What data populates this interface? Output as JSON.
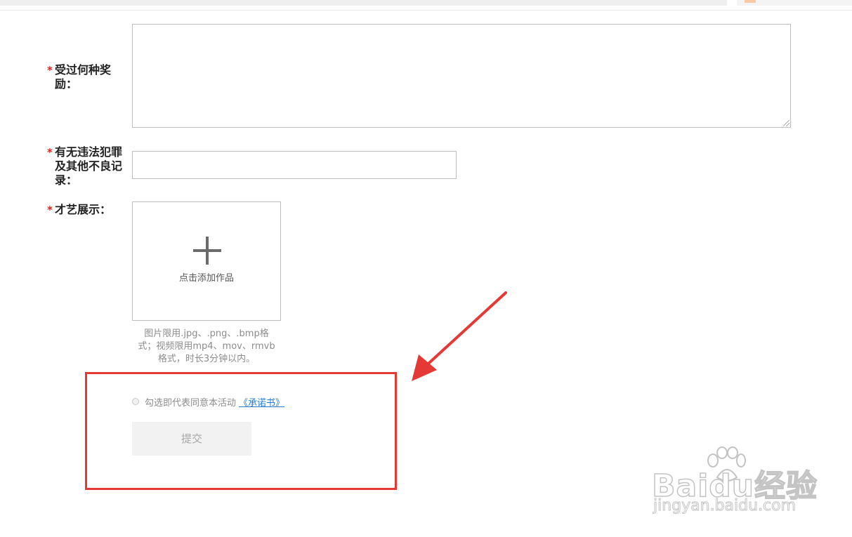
{
  "form": {
    "fields": [
      {
        "required_mark": "*",
        "label_line1": "受过何种奖",
        "label_line2": "励："
      },
      {
        "required_mark": "*",
        "label_line1": "有无违法犯罪",
        "label_line2": "及其他不良记",
        "label_line3": "录："
      },
      {
        "required_mark": "*",
        "label_line1": "才艺展示："
      }
    ],
    "awards_value": "",
    "record_value": ""
  },
  "upload": {
    "icon": "plus-icon",
    "label": "点击添加作品",
    "hint_line1": "图片限用.jpg、.png、.bmp格",
    "hint_line2": "式；视频限用mp4、mov、rmvb",
    "hint_line3": "格式，时长3分钟以内。"
  },
  "agreement": {
    "checked": false,
    "text": "勾选即代表同意本活动",
    "link": "《承诺书》"
  },
  "submit": {
    "label": "提交"
  },
  "annotation": {
    "color": "#e53935"
  },
  "watermark": {
    "main": "Baidu经验",
    "sub": "jingyan.baidu.com"
  },
  "colors": {
    "required": "#e02020",
    "link": "#2a7fd4",
    "hint": "#8c8c8c"
  }
}
